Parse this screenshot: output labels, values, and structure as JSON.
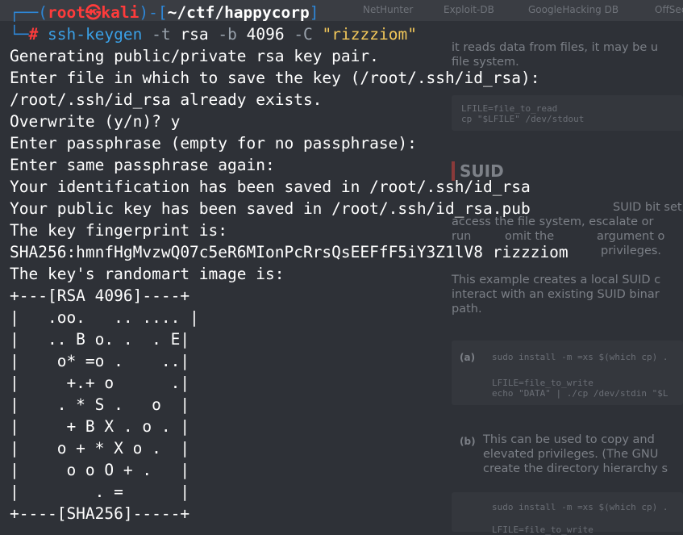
{
  "background": {
    "bookmarks": [
      "NetHunter",
      "Exploit-DB",
      "GoogleHacking DB",
      "OffSec"
    ],
    "texts": [
      "it reads data from files, it may be u",
      "file system.",
      "SUID bit set, i",
      "access the file system, escalate or",
      "run",
      "omit the",
      "argument o",
      "privileges.",
      "This example creates a local SUID c",
      "interact with an existing SUID binar",
      "path.",
      "This can be used to copy and",
      "elevated privileges. (The GNU",
      "create the directory hierarchy s"
    ],
    "heading": "SUID",
    "codes": [
      "LFILE=file_to_read\ncp \"$LFILE\" /dev/stdout",
      "sudo install -m =xs $(which cp) .",
      "LFILE=file_to_write\necho \"DATA\" | ./cp /dev/stdin \"$L",
      "sudo install -m =xs $(which cp) .",
      "LFILE=file_to_write"
    ],
    "labels": [
      "(a)",
      "(b)"
    ]
  },
  "terminal": {
    "prompt": {
      "top_left": "┌──(",
      "user": "root㉿kali",
      "mid": ")-[",
      "path": "~/ctf/happycorp",
      "end": "]",
      "bottom_left": "└─",
      "hash": "#"
    },
    "command": {
      "program": "ssh-keygen",
      "flag_t": "-t",
      "arg_t": "rsa",
      "flag_b": "-b",
      "arg_b": "4096",
      "flag_c": "-C",
      "arg_c": "\"rizzziom\""
    },
    "output": [
      "Generating public/private rsa key pair.",
      "Enter file in which to save the key (/root/.ssh/id_rsa):",
      "/root/.ssh/id_rsa already exists.",
      "Overwrite (y/n)? y",
      "Enter passphrase (empty for no passphrase):",
      "Enter same passphrase again:",
      "Your identification has been saved in /root/.ssh/id_rsa",
      "Your public key has been saved in /root/.ssh/id_rsa.pub",
      "The key fingerprint is:",
      "SHA256:hmnfHgMvzwQ07c5eR6MIonPcRrsQsEEFfF5iY3Z1lV8 rizzziom",
      "The key's randomart image is:",
      "+---[RSA 4096]----+",
      "|   .oo.   .. .... |",
      "|   .. B o. .  . E|",
      "|    o* =o .    ..|",
      "|     +.+ o      .|",
      "|    . * S .   o  |",
      "|     + B X . o . |",
      "|    o + * X o .  |",
      "|     o o O + .   |",
      "|        . =      |",
      "+----[SHA256]-----+"
    ]
  }
}
